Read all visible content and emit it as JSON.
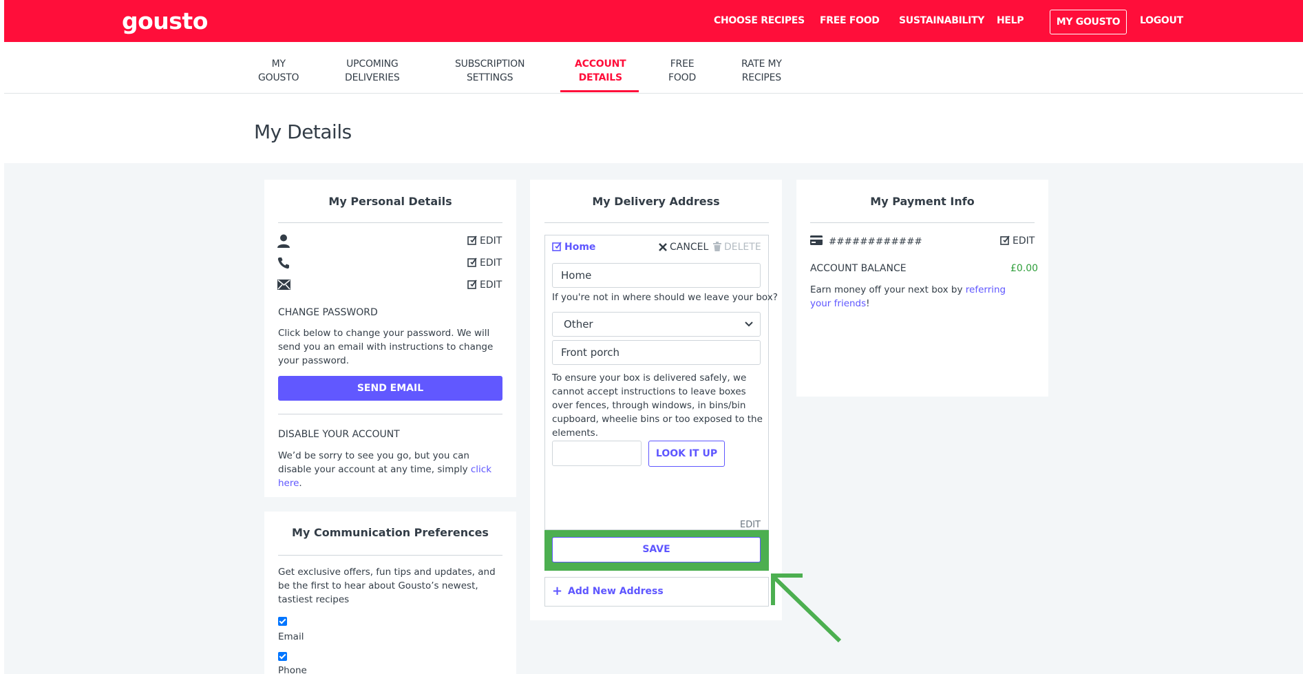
{
  "header": {
    "logo": "gousto",
    "nav": [
      "CHOOSE RECIPES",
      "FREE FOOD",
      "SUSTAINABILITY",
      "HELP"
    ],
    "my_gousto": "MY GOUSTO",
    "logout": "LOGOUT",
    "brand_color": "#ff0e3a"
  },
  "subnav": {
    "tabs": [
      {
        "line1": "MY",
        "line2": "GOUSTO"
      },
      {
        "line1": "UPCOMING",
        "line2": "DELIVERIES"
      },
      {
        "line1": "SUBSCRIPTION",
        "line2": "SETTINGS"
      },
      {
        "line1": "ACCOUNT",
        "line2": "DETAILS"
      },
      {
        "line1": "FREE",
        "line2": "FOOD"
      },
      {
        "line1": "RATE MY",
        "line2": "RECIPES"
      }
    ],
    "active_tab": "ACCOUNT DETAILS"
  },
  "page": {
    "title": "My Details"
  },
  "personal": {
    "title": "My Personal Details",
    "rows": [
      {
        "icon": "user-icon",
        "edit": "EDIT"
      },
      {
        "icon": "phone-icon",
        "edit": "EDIT"
      },
      {
        "icon": "envelope-icon",
        "edit": "EDIT"
      }
    ],
    "change_password_heading": "CHANGE PASSWORD",
    "change_password_text": "Click below to change your password. We will send you an email with instructions to change your password.",
    "send_email": "SEND EMAIL",
    "disable_heading": "DISABLE YOUR ACCOUNT",
    "disable_text": "We’d be sorry to see you go, but you can disable your account at any time, simply ",
    "disable_link": "click here",
    "disable_end": "."
  },
  "communication": {
    "title": "My Communication Preferences",
    "text": "Get exclusive offers, fun tips and updates, and be the first to hear about Gousto’s newest, tastiest recipes",
    "options": [
      {
        "label": "Email",
        "checked": true
      },
      {
        "label": "Phone",
        "checked": true
      }
    ]
  },
  "delivery": {
    "title": "My Delivery Address",
    "address_name": "Home",
    "cancel": "CANCEL",
    "delete": "DELETE",
    "name_value": "Home",
    "leave_question": "If you're not in where should we leave your box?",
    "leave_option": "Other",
    "leave_detail": "Front porch",
    "notice": "To ensure your box is delivered safely, we cannot accept instructions to leave boxes over fences, through windows, in bins/bin cupboard, wheelie bins or too exposed to the elements.",
    "postcode_placeholder": "",
    "look_it_up": "LOOK IT UP",
    "edit": "EDIT",
    "save": "SAVE",
    "add_new": "Add New Address",
    "highlight_color": "#4caf50"
  },
  "payment": {
    "title": "My Payment Info",
    "card_masked": "############",
    "edit": "EDIT",
    "balance_label": "ACCOUNT BALANCE",
    "balance_value": "£0.00",
    "earn_text": "Earn money off your next box by ",
    "earn_link": "referring your friends",
    "earn_end": "!"
  }
}
